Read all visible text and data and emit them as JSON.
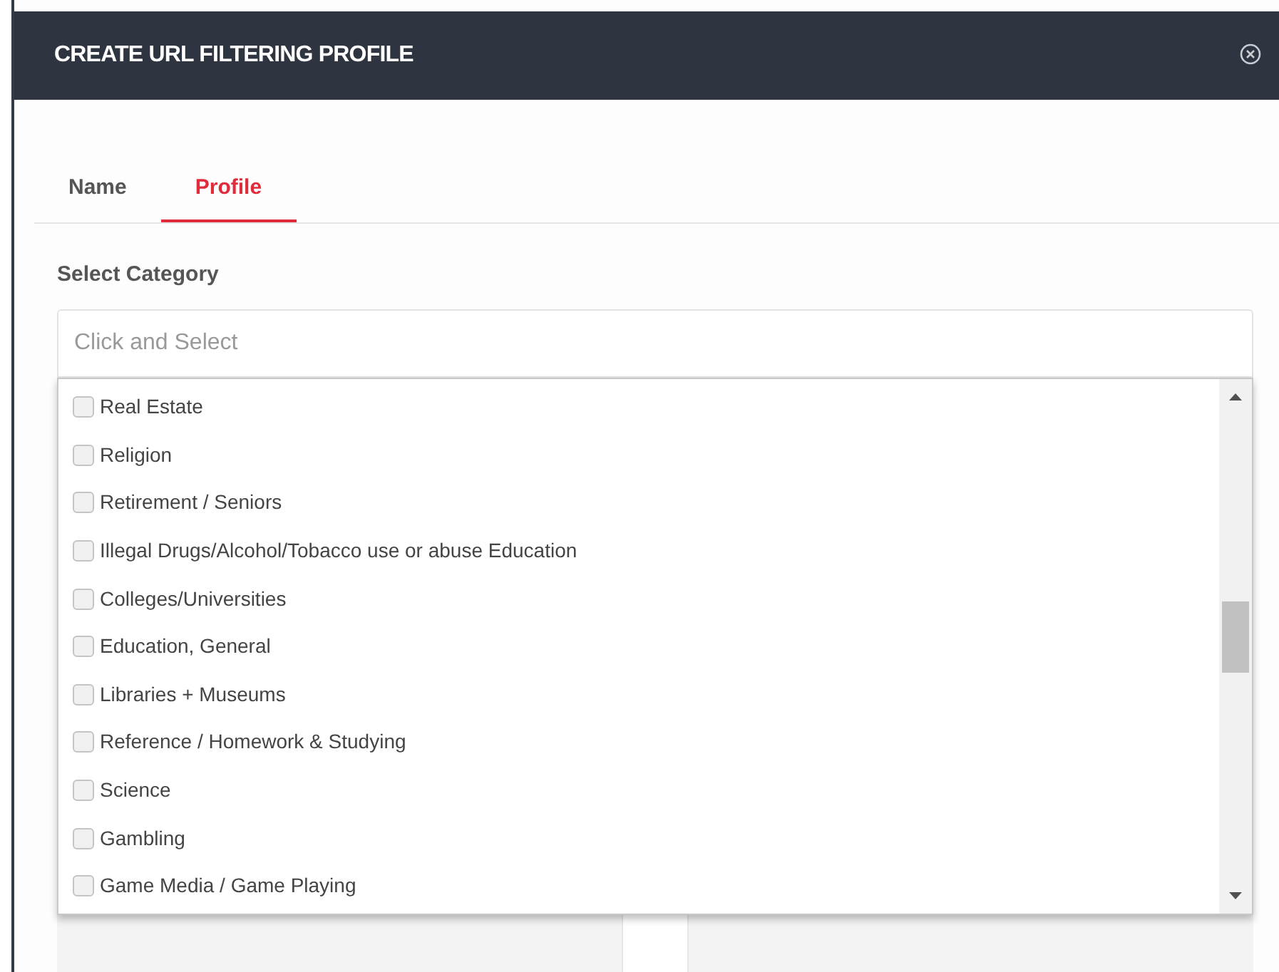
{
  "dialog": {
    "title": "CREATE URL FILTERING PROFILE"
  },
  "tabs": [
    {
      "label": "Name",
      "selected": false
    },
    {
      "label": "Profile",
      "selected": true
    }
  ],
  "category": {
    "label": "Select Category",
    "placeholder": "Click and Select"
  },
  "options": [
    {
      "label": "Real Estate",
      "checked": false
    },
    {
      "label": "Religion",
      "checked": false
    },
    {
      "label": "Retirement / Seniors",
      "checked": false
    },
    {
      "label": "Illegal Drugs/Alcohol/Tobacco use or abuse Education",
      "checked": false
    },
    {
      "label": "Colleges/Universities",
      "checked": false
    },
    {
      "label": "Education, General",
      "checked": false
    },
    {
      "label": "Libraries + Museums",
      "checked": false
    },
    {
      "label": "Reference / Homework & Studying",
      "checked": false
    },
    {
      "label": "Science",
      "checked": false
    },
    {
      "label": "Gambling",
      "checked": false
    },
    {
      "label": "Game Media / Game Playing",
      "checked": false
    }
  ]
}
